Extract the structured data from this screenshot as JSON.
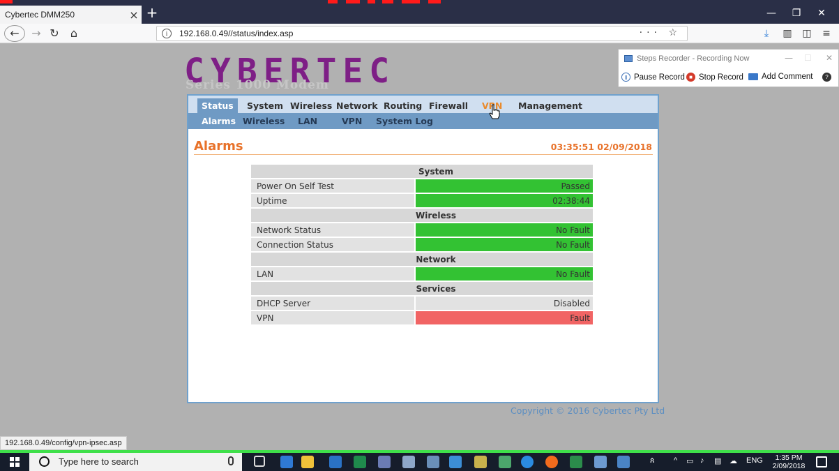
{
  "browser": {
    "tab_title": "Cybertec DMM250",
    "tab_close": "×",
    "new_tab": "+",
    "url": "192.168.0.49//status/index.asp",
    "url_actions": "··· ☆",
    "status_url": "192.168.0.49/config/vpn-ipsec.asp"
  },
  "page": {
    "logo_left": "CY",
    "logo_right": "BERTEC",
    "subtitle": "Series 1000 Modem",
    "menu": [
      "Status",
      "System",
      "Wireless",
      "Network",
      "Routing",
      "Firewall",
      "VPN",
      "Management"
    ],
    "submenu": [
      "Alarms",
      "Wireless",
      "LAN",
      "VPN",
      "System Log"
    ],
    "title": "Alarms",
    "timestamp": "03:35:51 02/09/2018",
    "copyright": "Copyright © 2016 Cybertec Pty Ltd",
    "alarms": {
      "system": {
        "heading": "System",
        "rows": [
          {
            "label": "Power On Self Test",
            "value": "Passed"
          },
          {
            "label": "Uptime",
            "value": "02:38:44"
          }
        ]
      },
      "wireless": {
        "heading": "Wireless",
        "rows": [
          {
            "label": "Network Status",
            "value": "No Fault"
          },
          {
            "label": "Connection Status",
            "value": "No Fault"
          }
        ]
      },
      "network": {
        "heading": "Network",
        "rows": [
          {
            "label": "LAN",
            "value": "No Fault"
          }
        ]
      },
      "services": {
        "heading": "Services",
        "rows": [
          {
            "label": "DHCP Server",
            "value": "Disabled"
          },
          {
            "label": "VPN",
            "value": "Fault"
          }
        ]
      }
    },
    "colors": {
      "ok": "#33c233",
      "fault": "#f16464",
      "accent": "#e8722a",
      "brand": "#7e1f86"
    }
  },
  "steps_recorder": {
    "title": "Steps Recorder - Recording Now",
    "pause": "Pause Record",
    "stop": "Stop Record",
    "comment": "Add Comment",
    "help": "?"
  },
  "taskbar": {
    "search_placeholder": "Type here to search",
    "language": "ENG",
    "time": "1:35 PM",
    "date": "2/09/2018"
  }
}
